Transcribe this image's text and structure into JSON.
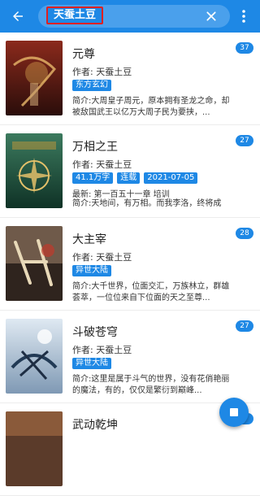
{
  "toolbar": {
    "search_query": "天蚕土豆",
    "icons": {
      "back": "arrow-left-icon",
      "clear": "close-icon",
      "more": "more-vert-icon"
    },
    "accent": "#1e88e5",
    "highlight": "#e02020"
  },
  "results": [
    {
      "title": "元尊",
      "author": "作者: 天蚕土豆",
      "tags": [
        "东方玄幻"
      ],
      "intro": "简介:大周皇子周元，原本拥有圣龙之命，却被敌国武王以亿万大周子民为要挟，...",
      "badge": "37"
    },
    {
      "title": "万相之王",
      "author": "作者: 天蚕土豆",
      "tags": [
        "41.1万字",
        "连载",
        "2021-07-05"
      ],
      "latest": "最新: 第一百五十一章 培训",
      "intro": "简介:天地间，有万相。而我李洛，终将成",
      "badge": "27"
    },
    {
      "title": "大主宰",
      "author": "作者: 天蚕土豆",
      "tags": [
        "异世大陆"
      ],
      "intro": "简介:大千世界，位面交汇，万族林立，群雄荟萃，一位位来自下位面的天之至尊...",
      "badge": "28"
    },
    {
      "title": "斗破苍穹",
      "author": "作者: 天蚕土豆",
      "tags": [
        "异世大陆"
      ],
      "intro": "简介:这里是属于斗气的世界，没有花俏艳丽的魔法，有的，仅仅是繁衍到巅峰...",
      "badge": "27"
    },
    {
      "title": "武动乾坤",
      "badge": "3"
    }
  ],
  "fab": {
    "icon": "stop-square-icon"
  }
}
